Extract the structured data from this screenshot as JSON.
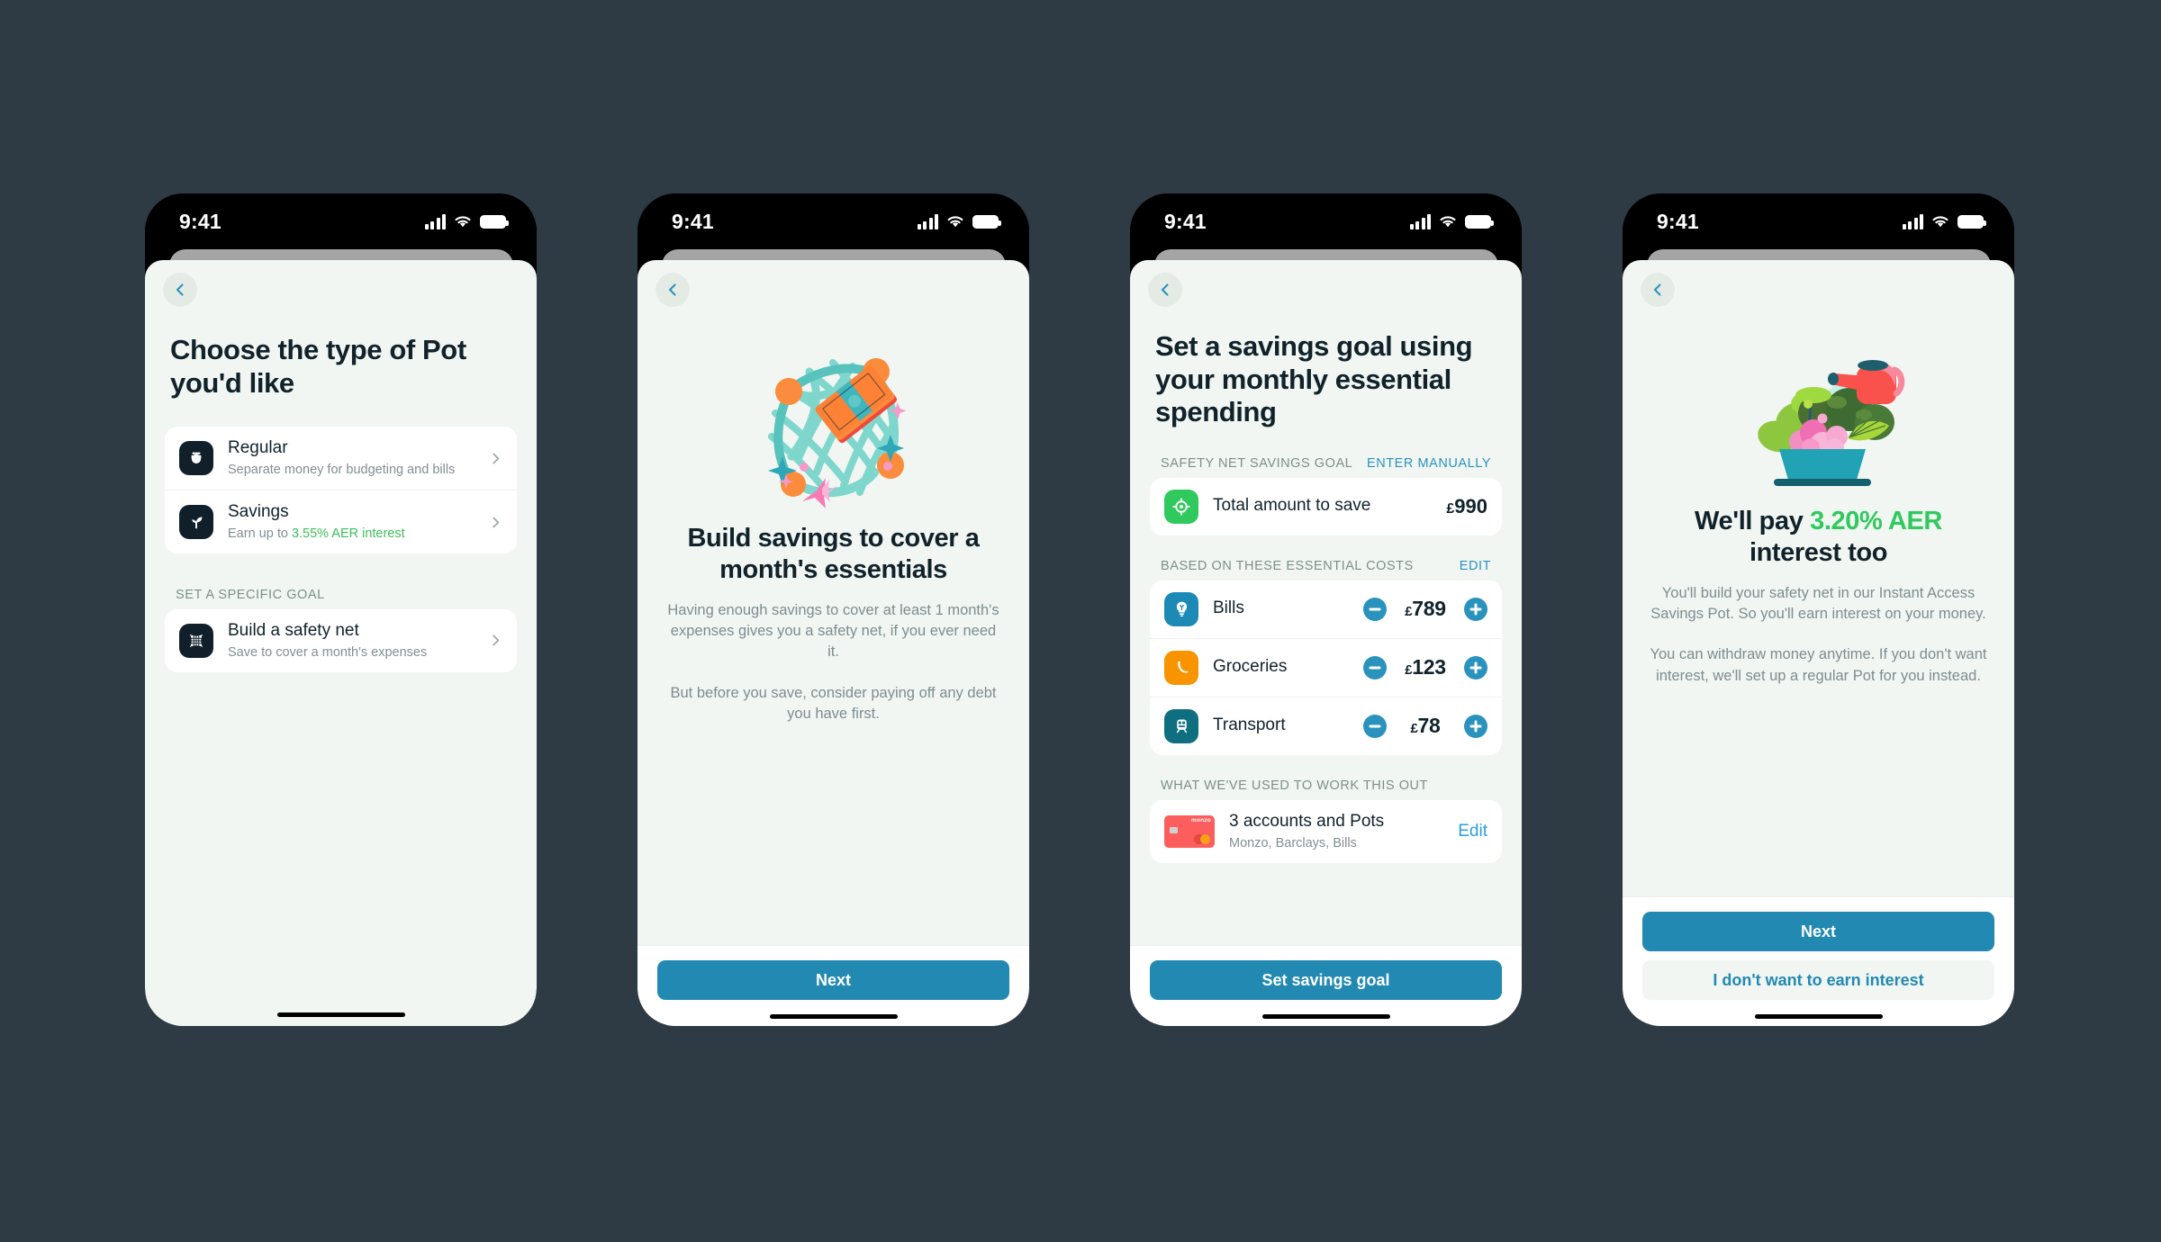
{
  "background_color": "#2e3b45",
  "accent_blue": "#2289b2",
  "accent_green": "#2fc95e",
  "status_bar": {
    "time": "9:41",
    "signal_icon": "cellular-bars-icon",
    "wifi_icon": "wifi-icon",
    "battery_icon": "battery-icon"
  },
  "screens": [
    {
      "id": "choose-pot-type",
      "back_icon": "chevron-left-icon",
      "headline": "Choose the type of Pot you'd like",
      "pot_types": [
        {
          "icon": "pot-icon",
          "title": "Regular",
          "subtitle": "Separate money for budgeting and bills",
          "chevron": "chevron-right-icon"
        },
        {
          "icon": "sprout-icon",
          "title": "Savings",
          "subtitle_prefix": "Earn up to ",
          "subtitle_highlight": "3.55% AER interest",
          "chevron": "chevron-right-icon"
        }
      ],
      "goal_section_label": "SET A SPECIFIC GOAL",
      "goal_items": [
        {
          "icon": "safety-net-icon",
          "title": "Build a safety net",
          "subtitle": "Save to cover a month's expenses",
          "chevron": "chevron-right-icon"
        }
      ]
    },
    {
      "id": "build-savings",
      "back_icon": "chevron-left-icon",
      "illustration": "safety-net-with-cash-illustration",
      "title": "Build savings to cover a month's essentials",
      "paragraphs": [
        "Having enough savings to cover at least 1 month's expenses gives you a safety net, if you ever need it.",
        "But before you save, consider paying off any debt you have first."
      ],
      "primary_button": "Next"
    },
    {
      "id": "set-savings-goal",
      "back_icon": "chevron-left-icon",
      "headline": "Set a savings goal using your monthly essential spending",
      "goal_section": {
        "label": "SAFETY NET SAVINGS GOAL",
        "action": "ENTER MANUALLY",
        "row": {
          "icon": "target-icon",
          "title": "Total amount to save",
          "currency": "£",
          "amount": "990"
        }
      },
      "costs_section": {
        "label": "BASED ON THESE ESSENTIAL COSTS",
        "action": "EDIT",
        "rows": [
          {
            "icon": "lightbulb-icon",
            "title": "Bills",
            "currency": "£",
            "amount": "789",
            "minus": "minus-button",
            "plus": "plus-button"
          },
          {
            "icon": "banana-icon",
            "title": "Groceries",
            "currency": "£",
            "amount": "123",
            "minus": "minus-button",
            "plus": "plus-button"
          },
          {
            "icon": "train-icon",
            "title": "Transport",
            "currency": "£",
            "amount": "78",
            "minus": "minus-button",
            "plus": "plus-button"
          }
        ]
      },
      "sources_section": {
        "label": "WHAT WE'VE USED TO WORK THIS OUT",
        "row": {
          "icon": "monzo-card-icon",
          "title": "3 accounts and Pots",
          "subtitle": "Monzo, Barclays, Bills",
          "action": "Edit"
        }
      },
      "primary_button": "Set savings goal"
    },
    {
      "id": "interest-rate",
      "back_icon": "chevron-left-icon",
      "illustration": "plant-pot-watering-can-illustration",
      "title_prefix": "We'll pay ",
      "title_highlight": "3.20% AER",
      "title_suffix": " interest too",
      "paragraphs": [
        "You'll build your safety net in our Instant Access Savings Pot. So you'll earn interest on your money.",
        "You can withdraw money anytime. If you don't want interest, we'll set up a regular Pot for you instead."
      ],
      "primary_button": "Next",
      "secondary_button": "I don't want to earn interest"
    }
  ]
}
